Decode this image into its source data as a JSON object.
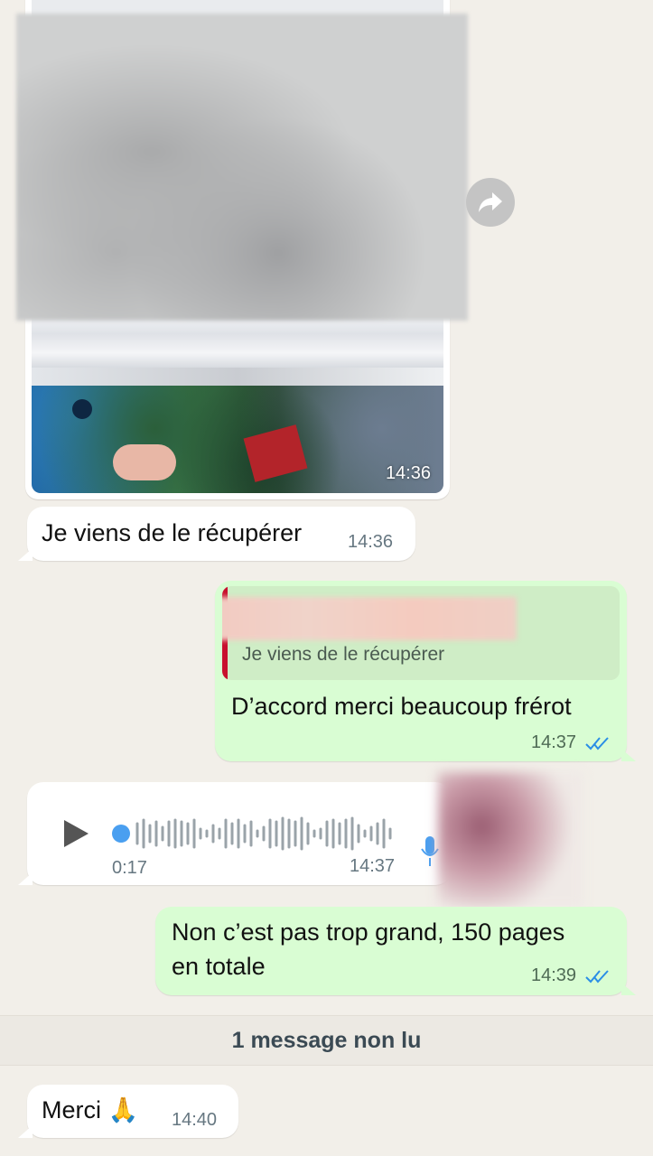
{
  "messages": {
    "image": {
      "time": "14:36"
    },
    "received_1": {
      "text": "Je viens de le récupérer",
      "time": "14:36"
    },
    "sent_reply": {
      "quoted_text": "Je viens de le récupérer",
      "text": "D’accord merci beaucoup frérot",
      "time": "14:37"
    },
    "voice": {
      "duration": "0:17",
      "time": "14:37"
    },
    "sent_2": {
      "text_line1": "Non c’est pas trop grand, 150 pages",
      "text_line2": "en totale",
      "time": "14:39"
    },
    "unread_label": "1 message non lu",
    "received_2": {
      "text": "Merci 🙏",
      "time": "14:40"
    }
  },
  "colors": {
    "background": "#f2efe9",
    "incoming_bubble": "#ffffff",
    "outgoing_bubble": "#d9fdd3",
    "read_ticks": "#2a8ee6",
    "voice_progress": "#4a9ff0",
    "quote_bar": "#c8102e"
  },
  "icons": [
    "forward-icon",
    "play-icon",
    "microphone-icon",
    "double-check-icon"
  ]
}
